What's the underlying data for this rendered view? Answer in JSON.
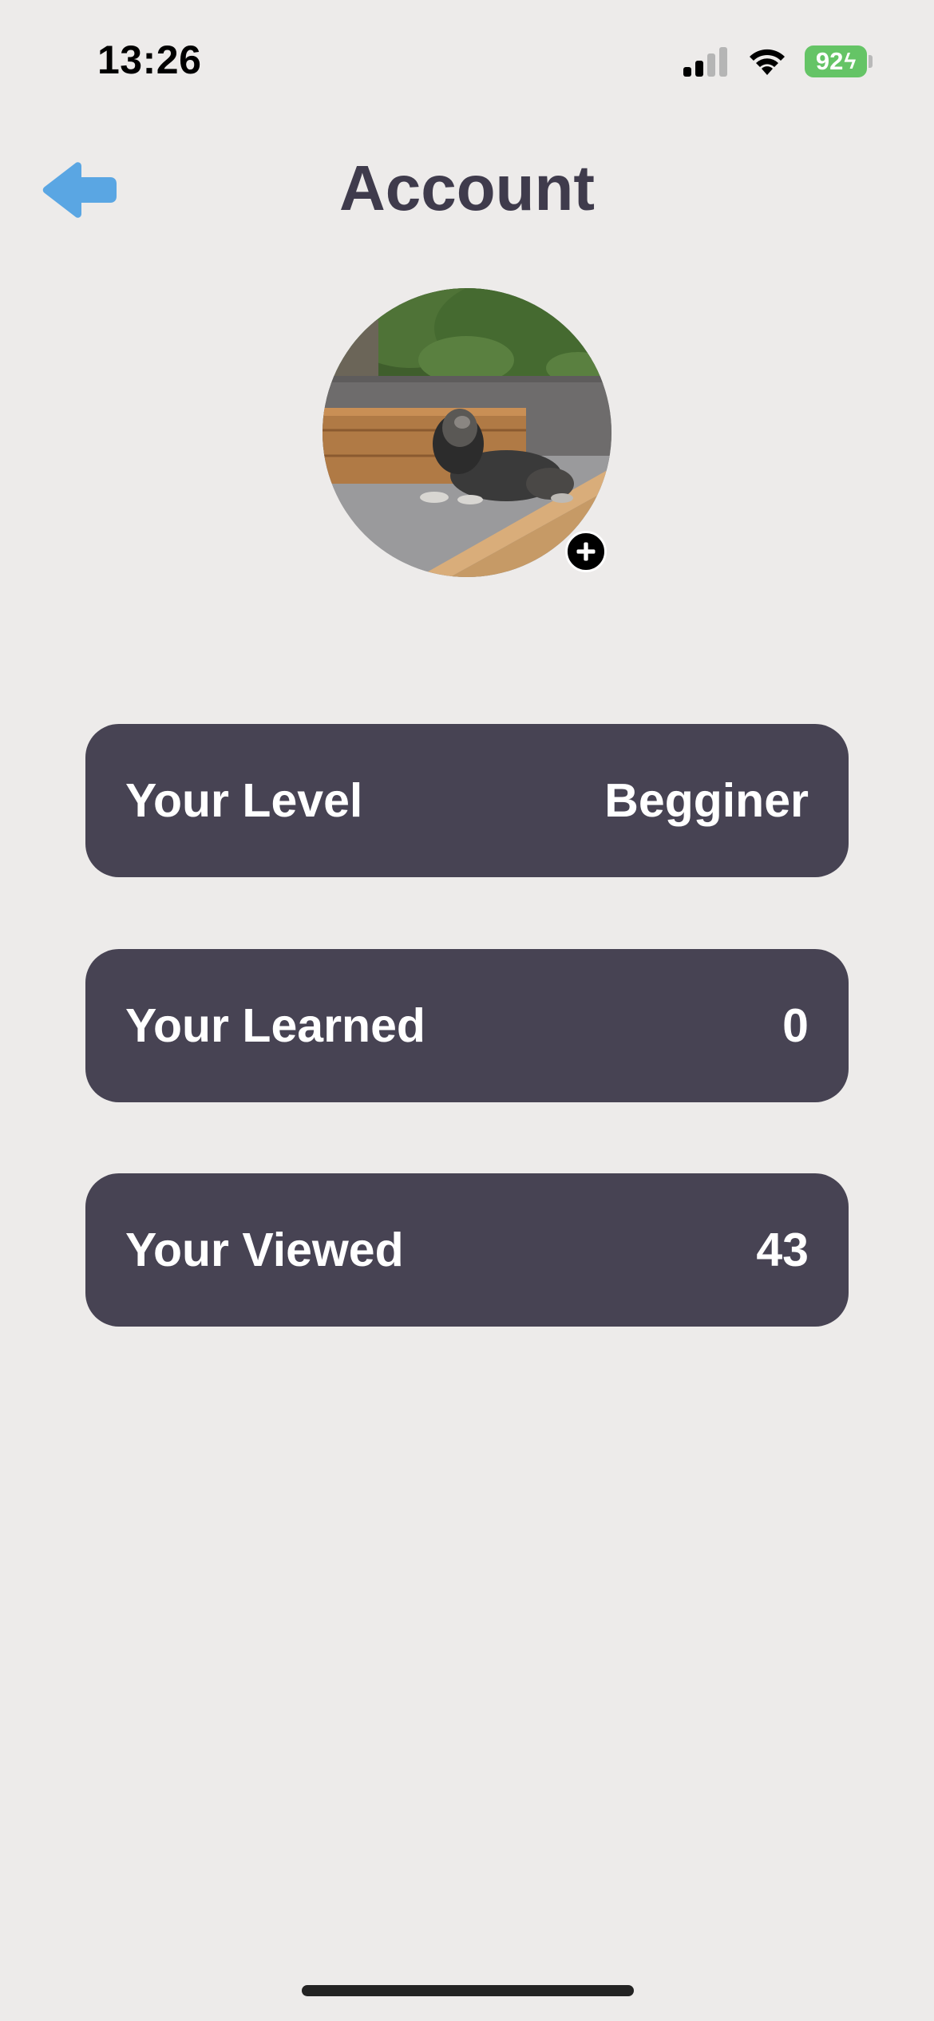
{
  "status_bar": {
    "time": "13:26",
    "battery_percent": "92",
    "icons": [
      "signal-icon",
      "wifi-icon",
      "battery-icon"
    ]
  },
  "header": {
    "title": "Account",
    "back_icon": "arrow-left-icon"
  },
  "avatar": {
    "add_icon": "plus-circle-icon"
  },
  "stats": {
    "level": {
      "label": "Your Level",
      "value": "Begginer"
    },
    "learned": {
      "label": "Your Learned",
      "value": "0"
    },
    "viewed": {
      "label": "Your Viewed",
      "value": "43"
    }
  },
  "colors": {
    "background": "#edebea",
    "card": "#474353",
    "title": "#3f3b4c",
    "back_arrow": "#5aa6e3",
    "battery": "#65c466"
  }
}
